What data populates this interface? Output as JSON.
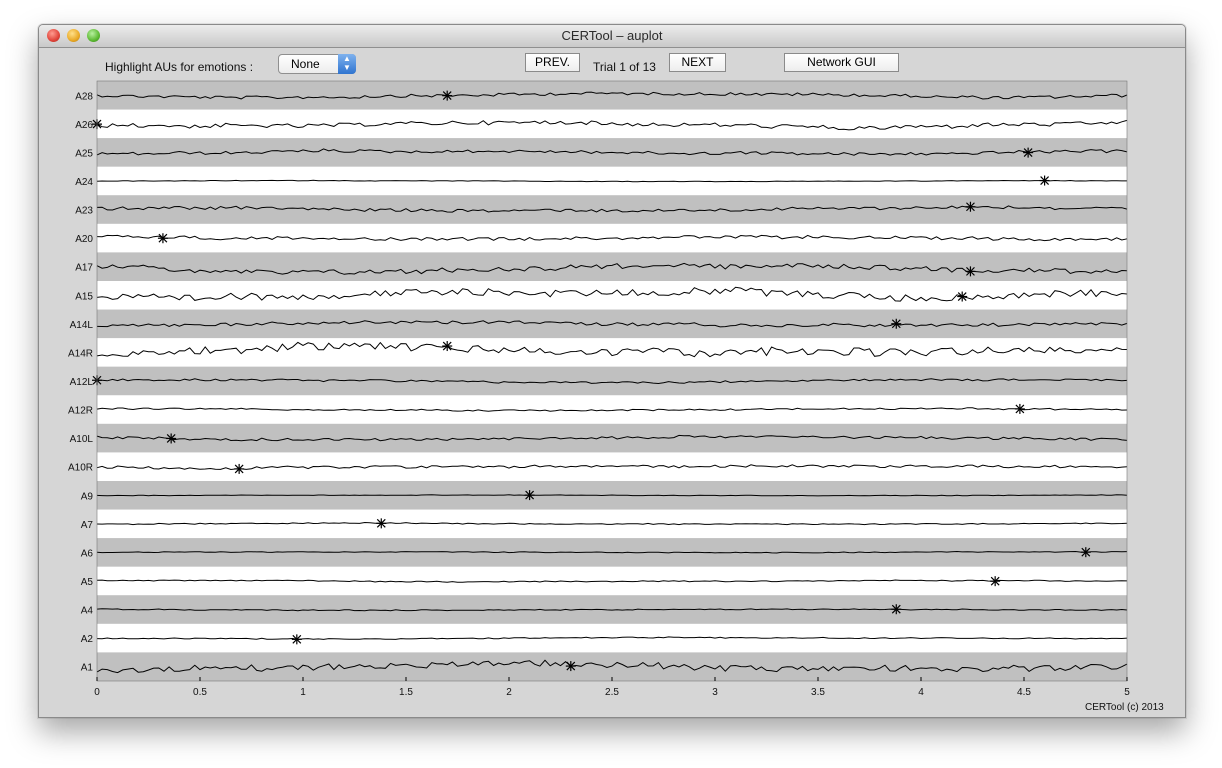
{
  "window": {
    "title": "CERTool – auplot"
  },
  "controls": {
    "highlight_label": "Highlight AUs for emotions :",
    "emotion_select_value": "None",
    "prev_label": "PREV.",
    "trial_text": "Trial 1 of 13",
    "next_label": "NEXT",
    "network_label": "Network GUI"
  },
  "footer": {
    "copyright": "CERTool (c) 2013"
  },
  "chart_data": {
    "type": "line",
    "xlim": [
      0,
      5
    ],
    "x_ticks": [
      "0",
      "0.5",
      "1",
      "1.5",
      "2",
      "2.5",
      "3",
      "3.5",
      "4",
      "4.5",
      "5"
    ],
    "band_colors": [
      "#c0c0c0",
      "#ffffff"
    ],
    "series": [
      {
        "name": "A28",
        "peak_time": 1.7
      },
      {
        "name": "A26",
        "peak_time": 0.0
      },
      {
        "name": "A25",
        "peak_time": 4.52
      },
      {
        "name": "A24",
        "peak_time": 4.6
      },
      {
        "name": "A23",
        "peak_time": 4.24
      },
      {
        "name": "A20",
        "peak_time": 0.32
      },
      {
        "name": "A17",
        "peak_time": 4.24
      },
      {
        "name": "A15",
        "peak_time": 4.2
      },
      {
        "name": "A14L",
        "peak_time": 3.88
      },
      {
        "name": "A14R",
        "peak_time": 1.7
      },
      {
        "name": "A12L",
        "peak_time": 0.0
      },
      {
        "name": "A12R",
        "peak_time": 4.48
      },
      {
        "name": "A10L",
        "peak_time": 0.36
      },
      {
        "name": "A10R",
        "peak_time": 0.69
      },
      {
        "name": "A9",
        "peak_time": 2.1
      },
      {
        "name": "A7",
        "peak_time": 1.38
      },
      {
        "name": "A6",
        "peak_time": 4.8
      },
      {
        "name": "A5",
        "peak_time": 4.36
      },
      {
        "name": "A4",
        "peak_time": 3.88
      },
      {
        "name": "A2",
        "peak_time": 0.97
      },
      {
        "name": "A1",
        "peak_time": 2.3
      }
    ]
  }
}
